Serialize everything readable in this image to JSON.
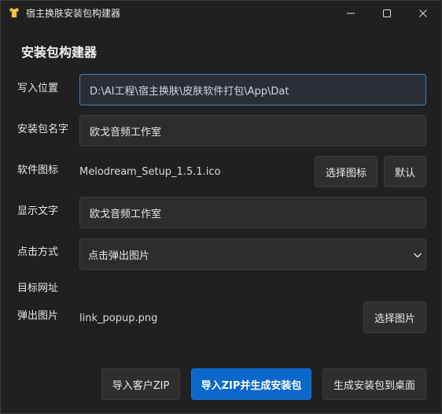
{
  "window": {
    "title": "宿主换肤安装包构建器"
  },
  "main": {
    "heading": "安装包构建器",
    "install_location": {
      "label": "写入位置",
      "value": "D:\\AI工程\\宿主换肤\\皮肤软件打包\\App\\Dat"
    },
    "package_name": {
      "label": "安装包名字",
      "value": "欧戈音频工作室"
    },
    "software_icon": {
      "label": "软件图标",
      "value": "Melodream_Setup_1.5.1.ico",
      "choose_label": "选择图标",
      "default_label": "默认"
    },
    "display_text": {
      "label": "显示文字",
      "value": "欧戈音频工作室"
    },
    "click_mode": {
      "label": "点击方式",
      "selected": "点击弹出图片"
    },
    "target_url": {
      "label": "目标网址"
    },
    "popup_image": {
      "label": "弹出图片",
      "value": "link_popup.png",
      "choose_label": "选择图片"
    }
  },
  "footer": {
    "import_client_zip": "导入客户ZIP",
    "import_zip_generate": "导入ZIP并生成安装包",
    "generate_to_desktop": "生成安装包到桌面"
  },
  "colors": {
    "background": "#202020",
    "field": "#2d2d2d",
    "focus_border": "#3d7fc4",
    "primary_button": "#0b67c9"
  }
}
